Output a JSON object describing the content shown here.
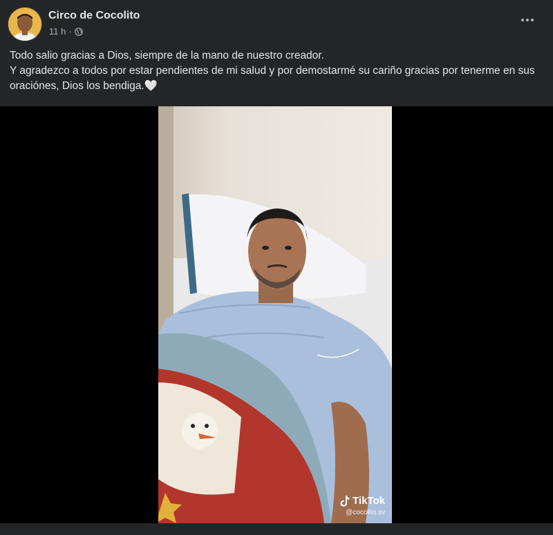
{
  "post": {
    "author": "Circo de Cocolito",
    "time": "11 h",
    "privacy_icon": "globe-icon",
    "more_icon": "more-options-icon",
    "text_lines": [
      "Todo salio gracias a Dios, siempre de la mano de nuestro creador.",
      "Y agradezco a todos por estar pendientes de mi salud y por demostarmé su cariño gracias por tenerme en sus oraciónes, Dios los bendiga.🤍"
    ]
  },
  "video": {
    "watermark_brand": "TikTok",
    "watermark_handle": "@cocolito.sv"
  },
  "colors": {
    "background": "#242526",
    "text": "#e4e6eb",
    "secondary_text": "#b0b3b8",
    "video_letterbox": "#000000"
  }
}
